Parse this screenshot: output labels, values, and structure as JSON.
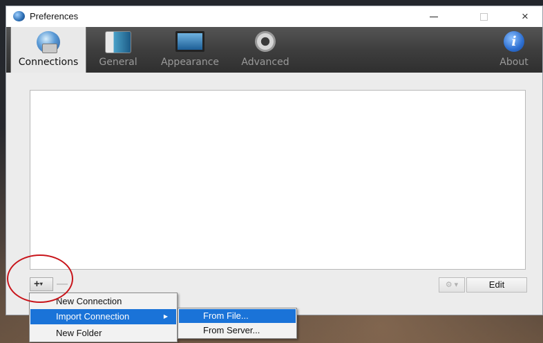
{
  "window": {
    "title": "Preferences",
    "controls": {
      "minimize": "minimize",
      "maximize": "maximize",
      "close": "×"
    }
  },
  "tabs": [
    {
      "label": "Connections",
      "icon": "connections-icon",
      "active": true
    },
    {
      "label": "General",
      "icon": "general-icon",
      "active": false
    },
    {
      "label": "Appearance",
      "icon": "appearance-icon",
      "active": false
    },
    {
      "label": "Advanced",
      "icon": "gear-icon",
      "active": false
    },
    {
      "label": "About",
      "icon": "info-icon",
      "active": false
    }
  ],
  "bottom_bar": {
    "add": "+",
    "add_caret": "▾",
    "remove": "—",
    "action": "⚙ ▾",
    "edit": "Edit"
  },
  "context_menu": {
    "items": [
      {
        "label": "New Connection",
        "selected": false
      },
      {
        "label": "Import Connection",
        "selected": true,
        "submenu_arrow": "▶"
      },
      {
        "label": "New Folder",
        "selected": false
      }
    ]
  },
  "submenu": {
    "items": [
      {
        "label": "From File...",
        "selected": true
      },
      {
        "label": "From Server...",
        "selected": false
      }
    ]
  },
  "colors": {
    "selection": "#1a73d8",
    "annotation_circle": "#c8141a"
  }
}
